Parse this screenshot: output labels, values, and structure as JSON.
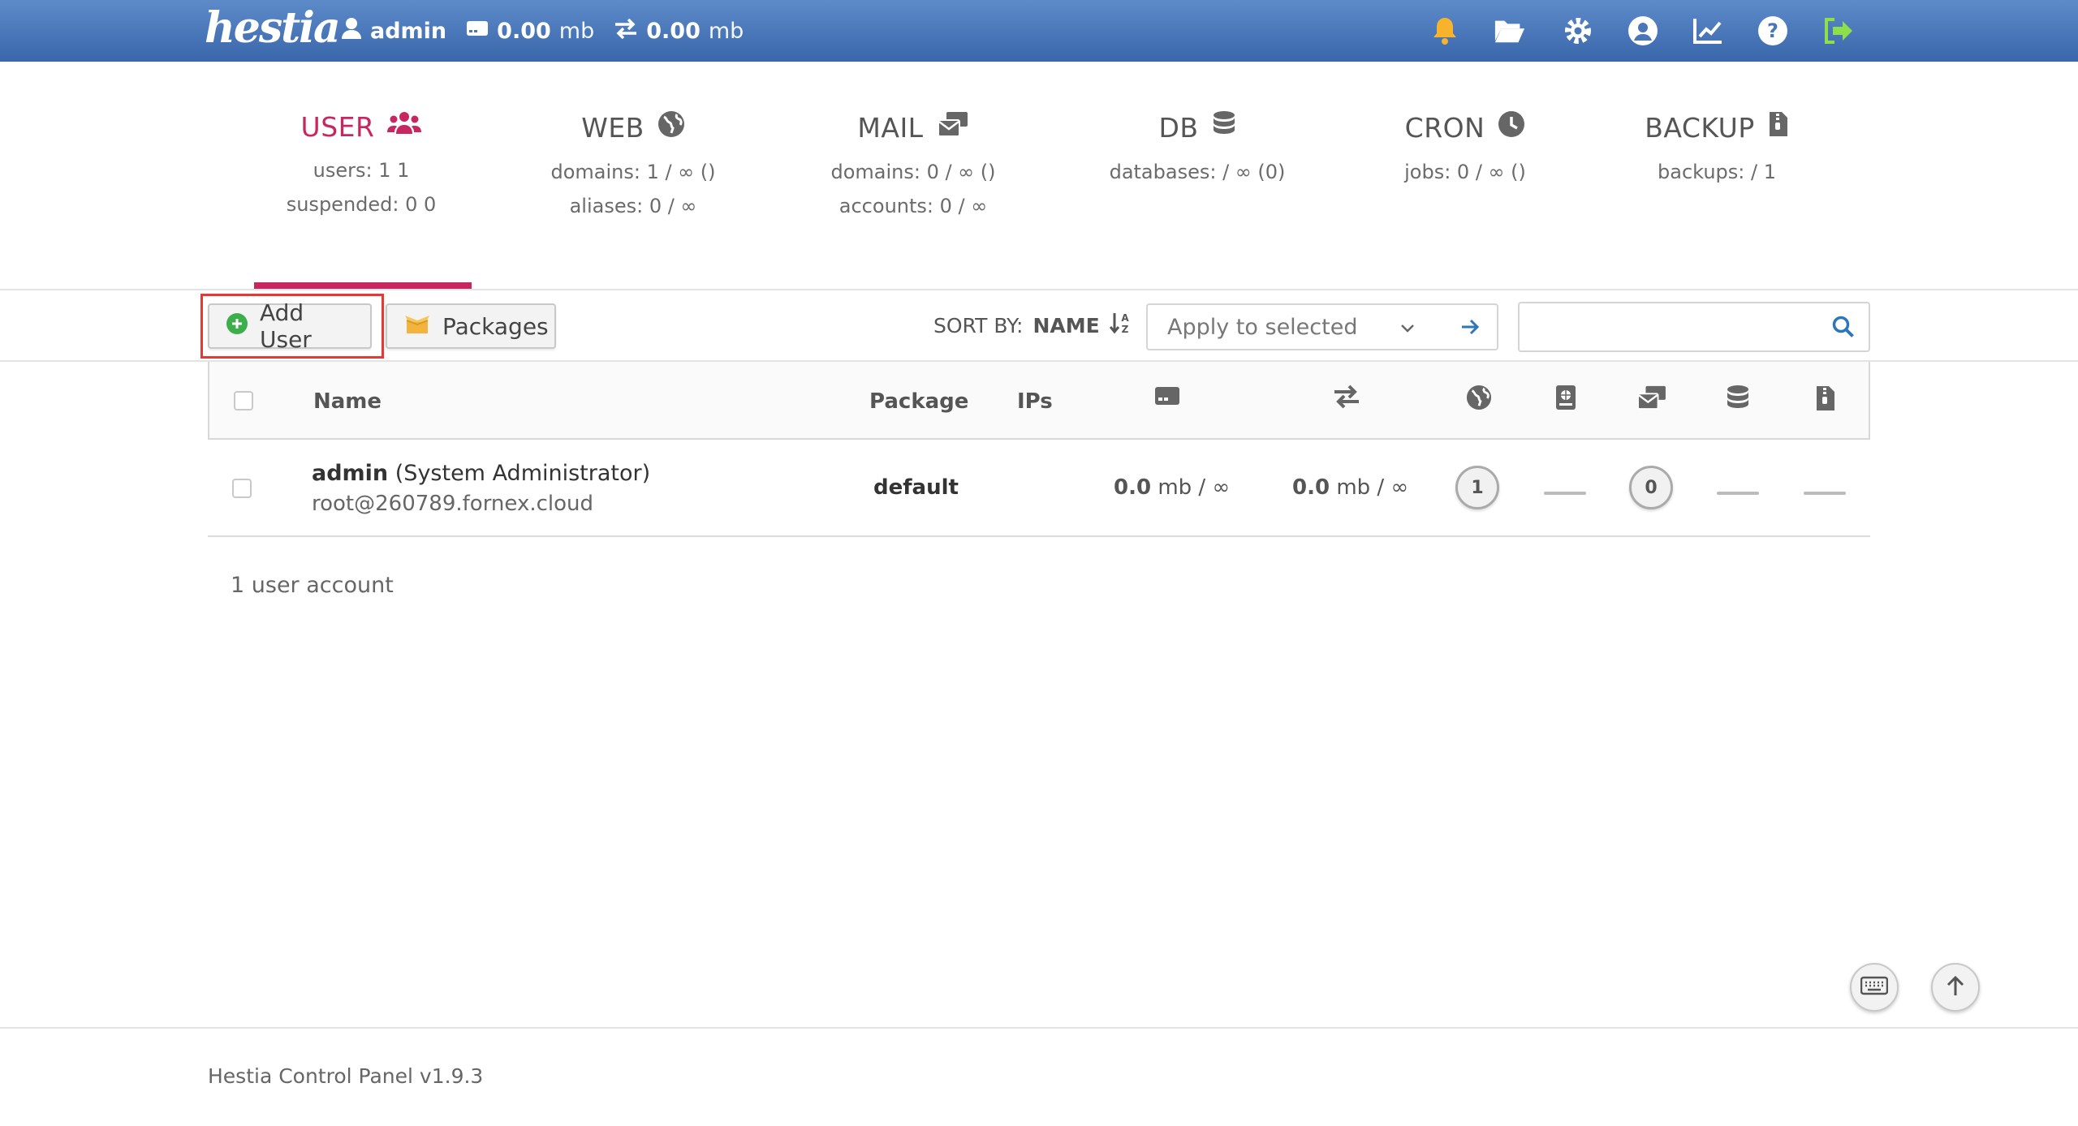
{
  "topbar": {
    "logo": "hestia",
    "user": "admin",
    "disk_value": "0.00",
    "disk_unit": "mb",
    "bandwidth_value": "0.00",
    "bandwidth_unit": "mb",
    "icons": [
      "bell-icon",
      "folder-open-icon",
      "gear-icon",
      "user-circle-icon",
      "chart-line-icon",
      "question-circle-icon",
      "sign-out-icon"
    ]
  },
  "tabs": [
    {
      "title": "USER",
      "line1": "users: 1 1",
      "line2": "suspended: 0 0",
      "icon": "users-icon",
      "active": true
    },
    {
      "title": "WEB",
      "line1": "domains: 1 / ∞ ()",
      "line2": "aliases: 0 / ∞",
      "icon": "globe-icon"
    },
    {
      "title": "MAIL",
      "line1": "domains: 0 / ∞ ()",
      "line2": "accounts: 0 / ∞",
      "icon": "mail-bulk-icon"
    },
    {
      "title": "DB",
      "line1": "databases: / ∞ (0)",
      "line2": "",
      "icon": "database-icon"
    },
    {
      "title": "CRON",
      "line1": "jobs: 0 / ∞ ()",
      "line2": "",
      "icon": "clock-icon"
    },
    {
      "title": "BACKUP",
      "line1": "backups: / 1",
      "line2": "",
      "icon": "file-archive-icon"
    }
  ],
  "toolbar": {
    "add_user_label": "Add User",
    "packages_label": "Packages",
    "sort_label": "SORT BY:",
    "sort_value": "NAME",
    "apply_placeholder": "Apply to selected",
    "search_placeholder": ""
  },
  "table": {
    "headers": {
      "name": "Name",
      "package": "Package",
      "ips": "IPs"
    },
    "rows": [
      {
        "username": "admin",
        "fullname": "(System Administrator)",
        "email": "root@260789.fornex.cloud",
        "package": "default",
        "disk_value": "0.0",
        "disk_unit": "mb / ∞",
        "bw_value": "0.0",
        "bw_unit": "mb / ∞",
        "web_domains": "1",
        "mail_domains": "0"
      }
    ]
  },
  "count_text": "1 user account",
  "footer_text": "Hestia Control Panel v1.9.3",
  "colors": {
    "accent": "#c7265e",
    "topbar": "#4a76b8",
    "highlight": "#e53935"
  }
}
